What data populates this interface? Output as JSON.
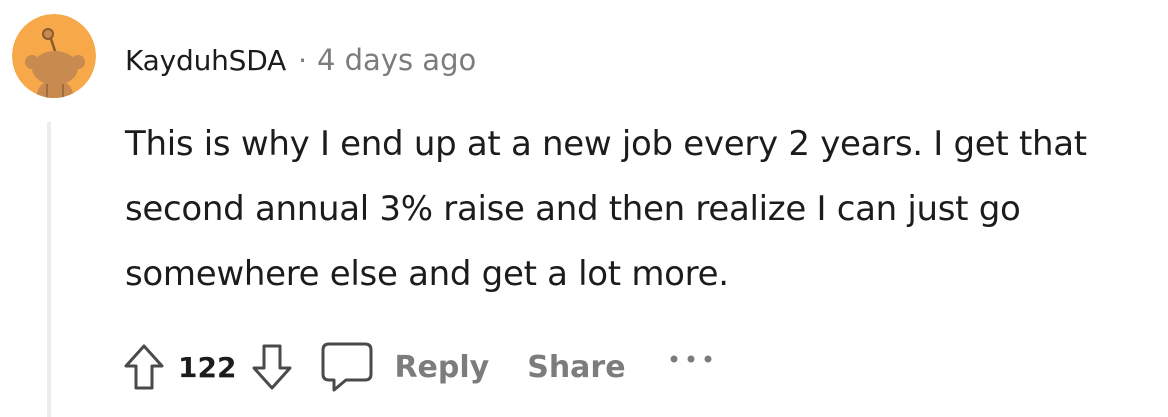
{
  "comment": {
    "author": "KayduhSDA",
    "separator": "·",
    "timestamp": "4 days ago",
    "body": "This is why I end up at a new job every 2 years. I get that second annual 3% raise and then realize I can just go somewhere else and get a lot more.",
    "score": "122"
  },
  "actions": {
    "reply_label": "Reply",
    "share_label": "Share"
  },
  "icons": {
    "avatar": "snoo-avatar-icon",
    "upvote": "arrow-up-icon",
    "downvote": "arrow-down-icon",
    "comment": "speech-bubble-icon",
    "more": "ellipsis-icon"
  },
  "colors": {
    "avatar_bg": "#f7a94a",
    "avatar_figure": "#c88a4f",
    "text_primary": "#1c1c1c",
    "text_secondary": "#7c7c7c",
    "thread_line": "#ededed"
  }
}
